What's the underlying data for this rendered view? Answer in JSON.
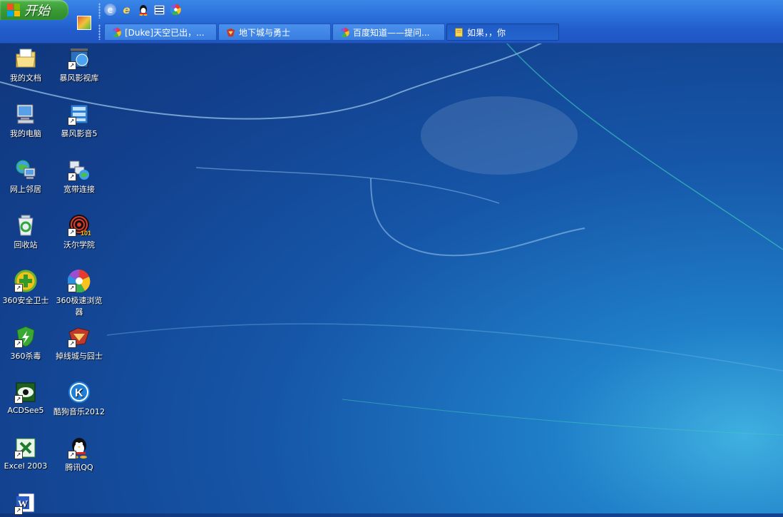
{
  "taskbar": {
    "start_label": "开始",
    "quick_launch": [
      "browser-icon",
      "ie-icon",
      "qq-icon",
      "media-icon",
      "360-browser-icon"
    ],
    "tasks": [
      {
        "label": "[Duke]天空已出，...",
        "icon": "360-browser-icon",
        "active": false
      },
      {
        "label": "地下城与勇士",
        "icon": "dnf-icon",
        "active": false
      },
      {
        "label": "百度知道——提问...",
        "icon": "360-browser-icon",
        "active": false
      },
      {
        "label": "如果，，你",
        "icon": "note-icon",
        "active": true
      }
    ]
  },
  "desktop": {
    "icons": [
      {
        "label": "我的文档",
        "icon": "my-documents-icon"
      },
      {
        "label": "暴风影视库",
        "icon": "storm-library-icon"
      },
      {
        "label": "我的电脑",
        "icon": "my-computer-icon"
      },
      {
        "label": "暴风影音5",
        "icon": "storm-player-icon"
      },
      {
        "label": "网上邻居",
        "icon": "network-places-icon"
      },
      {
        "label": "宽带连接",
        "icon": "broadband-icon"
      },
      {
        "label": "回收站",
        "icon": "recycle-bin-icon"
      },
      {
        "label": "沃尔学院",
        "icon": "wall-academy-icon"
      },
      {
        "label": "360安全卫士",
        "icon": "360-safe-icon"
      },
      {
        "label": "360极速浏览器",
        "icon": "360-chrome-icon"
      },
      {
        "label": "360杀毒",
        "icon": "360-antivirus-icon"
      },
      {
        "label": "掉线城与囧士",
        "icon": "dnf-game-icon"
      },
      {
        "label": "ACDSee5",
        "icon": "acdsee-icon"
      },
      {
        "label": "酷狗音乐2012",
        "icon": "kugou-icon"
      },
      {
        "label": "Excel 2003",
        "icon": "excel-icon"
      },
      {
        "label": "腾讯QQ",
        "icon": "qq-icon"
      },
      {
        "label": "",
        "icon": "word-icon"
      }
    ]
  },
  "colors": {
    "taskbar": "#2a6fd9",
    "start": "#3a9b35",
    "desktop": "#1656a8"
  }
}
